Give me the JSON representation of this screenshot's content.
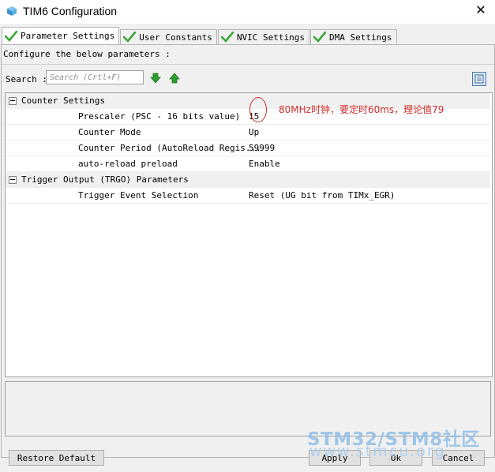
{
  "window": {
    "title": "TIM6 Configuration",
    "close_glyph": "✕",
    "icon": "cube-icon"
  },
  "tabs": [
    {
      "label": "Parameter Settings",
      "active": true
    },
    {
      "label": "User Constants",
      "active": false
    },
    {
      "label": "NVIC Settings",
      "active": false
    },
    {
      "label": "DMA Settings",
      "active": false
    }
  ],
  "panel": {
    "instruction": "Configure the below parameters :",
    "search_label": "Search :",
    "search_placeholder": "Search (Crtl+F)"
  },
  "tree": {
    "groups": [
      {
        "label": "Counter Settings",
        "params": [
          {
            "name": "Prescaler (PSC - 16 bits value)",
            "value": "15"
          },
          {
            "name": "Counter Mode",
            "value": "Up"
          },
          {
            "name": "Counter Period (AutoReload Regis...",
            "value": "59999"
          },
          {
            "name": "auto-reload preload",
            "value": "Enable"
          }
        ]
      },
      {
        "label": "Trigger Output (TRGO) Parameters",
        "params": [
          {
            "name": "Trigger Event Selection",
            "value": "Reset (UG bit from TIMx_EGR)"
          }
        ]
      }
    ]
  },
  "annotation": {
    "text": "80MHz时钟，要定时60ms，理论值79",
    "color": "#d62b2b"
  },
  "buttons": {
    "restore_default": "Restore Default",
    "apply": "Apply",
    "ok": "Ok",
    "cancel": "Cancel"
  },
  "watermark": {
    "line1": "STM32/STM8社区",
    "line2": "www.stmcu.org"
  },
  "colors": {
    "check_green": "#3aa635",
    "arrow_green": "#2e9e2e",
    "accent_blue": "#4a78b8"
  }
}
